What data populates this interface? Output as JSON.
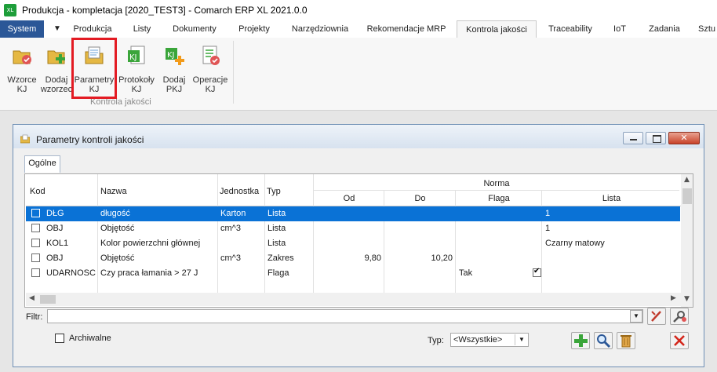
{
  "window": {
    "title": "Produkcja - kompletacja [2020_TEST3] - Comarch ERP XL 2021.0.0",
    "app_icon_text": "XL"
  },
  "ribbon_tabs": [
    "System",
    "Produkcja",
    "Listy",
    "Dokumenty",
    "Projekty",
    "Narzędziownia",
    "Rekomendacje MRP",
    "Kontrola jakości",
    "Traceability",
    "IoT",
    "Zadania",
    "Sztu"
  ],
  "ribbon_tabs_active": "Kontrola jakości",
  "ribbon_buttons": [
    {
      "label1": "Wzorce",
      "label2": "KJ",
      "icon": "templates-icon"
    },
    {
      "label1": "Dodaj",
      "label2": "wzorzec",
      "icon": "add-template-icon"
    },
    {
      "label1": "Parametry",
      "label2": "KJ",
      "icon": "parameters-icon"
    },
    {
      "label1": "Protokoły",
      "label2": "KJ",
      "icon": "protocols-icon"
    },
    {
      "label1": "Dodaj",
      "label2": "PKJ",
      "icon": "add-protocol-icon"
    },
    {
      "label1": "Operacje",
      "label2": "KJ",
      "icon": "operations-icon"
    }
  ],
  "ribbon_group_label": "Kontrola jakości",
  "dialog": {
    "title": "Parametry kontroli jakości",
    "tab": "Ogólne",
    "columns": {
      "kod": "Kod",
      "nazwa": "Nazwa",
      "jednostka": "Jednostka",
      "typ": "Typ",
      "norma": "Norma",
      "od": "Od",
      "do": "Do",
      "flaga": "Flaga",
      "lista": "Lista"
    },
    "rows": [
      {
        "kod": "DŁG",
        "nazwa": "długość",
        "jednostka": "Karton",
        "typ": "Lista",
        "od": "",
        "do": "",
        "flaga": "",
        "flaga_checked": false,
        "lista": "1",
        "selected": true
      },
      {
        "kod": "OBJ",
        "nazwa": "Objętość",
        "jednostka": "cm^3",
        "typ": "Lista",
        "od": "",
        "do": "",
        "flaga": "",
        "flaga_checked": false,
        "lista": "1",
        "selected": false
      },
      {
        "kod": "KOL1",
        "nazwa": "Kolor powierzchni głównej",
        "jednostka": "",
        "typ": "Lista",
        "od": "",
        "do": "",
        "flaga": "",
        "flaga_checked": false,
        "lista": "Czarny matowy",
        "selected": false
      },
      {
        "kod": "OBJ",
        "nazwa": "Objętość",
        "jednostka": "cm^3",
        "typ": "Zakres",
        "od": "9,80",
        "do": "10,20",
        "flaga": "",
        "flaga_checked": false,
        "lista": "",
        "selected": false
      },
      {
        "kod": "UDARNOSC",
        "nazwa": "Czy praca łamania > 27 J",
        "jednostka": "",
        "typ": "Flaga",
        "od": "",
        "do": "",
        "flaga": "Tak",
        "flaga_checked": true,
        "lista": "",
        "selected": false
      }
    ],
    "filter_label": "Filtr:",
    "filter_value": "",
    "archived_label": "Archiwalne",
    "type_label": "Typ:",
    "type_value": "<Wszystkie>"
  },
  "colors": {
    "system_tab": "#2b5797",
    "selection": "#0a72d6",
    "highlight_frame": "#e31b23"
  }
}
